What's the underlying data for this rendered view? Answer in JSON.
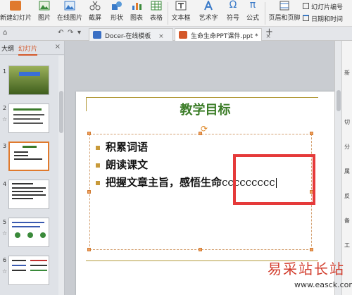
{
  "ribbon": {
    "buttons": [
      {
        "label": "新建幻灯片",
        "icon": "new-slide-icon",
        "color": "#e07a2d"
      },
      {
        "label": "图片",
        "icon": "picture-icon",
        "color": "#3a8a3a"
      },
      {
        "label": "在线图片",
        "icon": "online-picture-icon",
        "color": "#3a7ac8"
      },
      {
        "label": "截屏",
        "icon": "screenshot-icon",
        "color": "#555555"
      },
      {
        "label": "形状",
        "icon": "shape-icon",
        "color": "#3a7ac8"
      },
      {
        "label": "图表",
        "icon": "chart-icon",
        "color": "#3a7ac8"
      },
      {
        "label": "表格",
        "icon": "table-icon",
        "color": "#3a8a3a"
      },
      {
        "label": "文本框",
        "icon": "textbox-icon",
        "color": "#555555"
      },
      {
        "label": "艺术字",
        "icon": "wordart-icon",
        "color": "#3a7ac8"
      },
      {
        "label": "符号",
        "icon": "symbol-icon",
        "color": "#3a7ac8"
      },
      {
        "label": "公式",
        "icon": "formula-icon",
        "color": "#3a7ac8"
      },
      {
        "label": "页眉和页脚",
        "icon": "header-footer-icon",
        "color": "#555555"
      },
      {
        "label": "幻灯片编号",
        "icon": "slide-number-icon",
        "color": "#555555"
      },
      {
        "label": "日期和时间",
        "icon": "date-time-icon",
        "color": "#555555"
      }
    ]
  },
  "tabs": [
    {
      "label": "Docer-在线模板",
      "close": "×",
      "color": "#3a6fc4"
    },
    {
      "label": "生命生命PPT课件.ppt *",
      "close": "×",
      "color": "#d4582a"
    }
  ],
  "tab_add": "+",
  "quick_access": [
    "⌂",
    "↶",
    "↷",
    "▾"
  ],
  "left_pane": {
    "tabs": [
      "大纲",
      "幻灯片"
    ],
    "close": "×",
    "slide_numbers": [
      "1",
      "2",
      "3",
      "4",
      "5",
      "6"
    ]
  },
  "slide": {
    "title": "教学目标",
    "bullets": [
      "积累词语",
      "朗读课文",
      "把握文章主旨，感悟生命"
    ],
    "typed_text": "ccccccccc"
  },
  "right_panel": [
    "新",
    "切",
    "分",
    "属",
    "反",
    "备",
    "工"
  ],
  "watermark": {
    "text": "易采站长站",
    "url": "www.easck.com"
  }
}
